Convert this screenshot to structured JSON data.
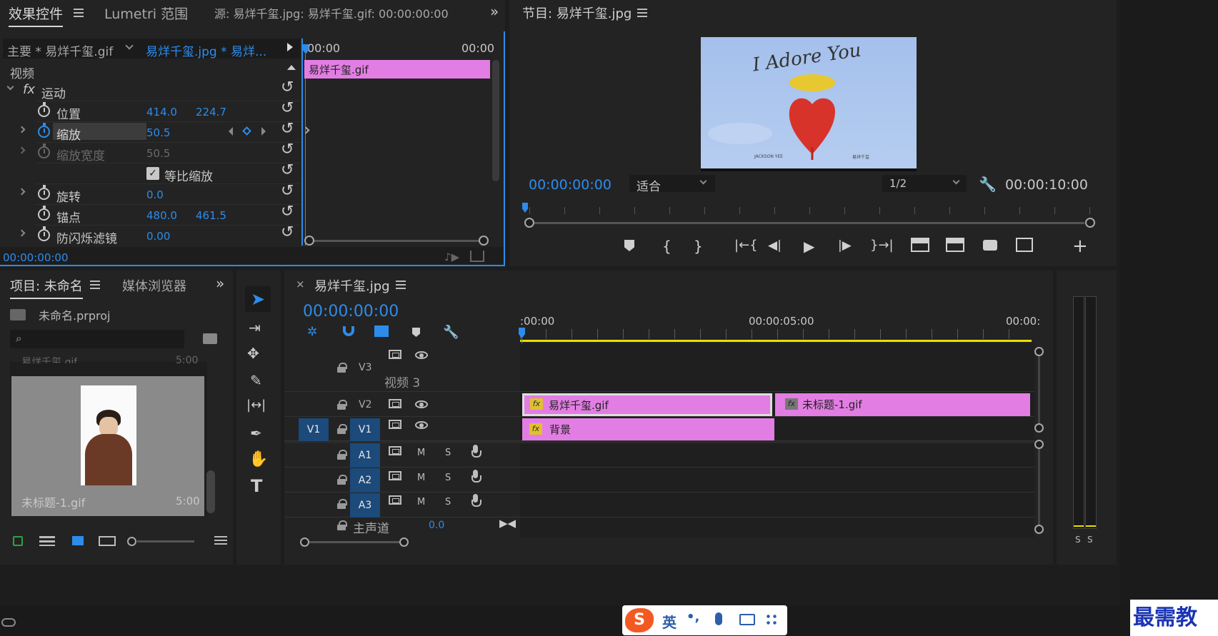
{
  "effect_controls": {
    "tab_label": "效果控件",
    "lumetri_tab": "Lumetri 范围",
    "source_label": "源: 易烊千玺.jpg: 易烊千玺.gif: 00:00:00:00",
    "master_clip": "主要 * 易烊千玺.gif",
    "sequence_clip": "易烊千玺.jpg * 易烊...",
    "ruler_start": "00:00",
    "ruler_end": "00:00",
    "timeline_clip": "易烊千玺.gif",
    "video_header": "视频",
    "fx_symbol": "fx",
    "motion_label": "运动",
    "properties": [
      {
        "name": "位置",
        "v1": "414.0",
        "v2": "224.7"
      },
      {
        "name": "缩放",
        "v1": "50.5",
        "v2": ""
      },
      {
        "name": "缩放宽度",
        "v1": "50.5",
        "v2": ""
      },
      {
        "name": "等比缩放",
        "v1": "",
        "v2": ""
      },
      {
        "name": "旋转",
        "v1": "0.0",
        "v2": ""
      },
      {
        "name": "锚点",
        "v1": "480.0",
        "v2": "461.5"
      },
      {
        "name": "防闪烁滤镜",
        "v1": "0.00",
        "v2": ""
      }
    ],
    "timecode": "00:00:00:00"
  },
  "program_monitor": {
    "title": "节目: 易烊千玺.jpg",
    "image_title": "I Adore You",
    "image_credit_left": "JACKSON YEE",
    "image_credit_right": "易烊千玺",
    "timecode_current": "00:00:00:00",
    "fit_select": "适合",
    "resolution_select": "1/2",
    "timecode_duration": "00:00:10:00"
  },
  "project": {
    "tab_label": "项目: 未命名",
    "media_tab": "媒体浏览器",
    "project_file": "未命名.prproj",
    "search_placeholder": "",
    "item_partial_name": "易烊千玺.gif",
    "item_partial_duration": "5:00",
    "item_name": "未标题-1.gif",
    "item_duration": "5:00"
  },
  "timeline": {
    "tab_label": "易烊千玺.jpg",
    "timecode": "00:00:00:00",
    "ruler_labels": [
      ":00:00",
      "00:00:05:00",
      "00:00:"
    ],
    "tracks": {
      "v3": "V3",
      "v3_name": "视频 3",
      "v2": "V2",
      "v1_source": "V1",
      "v1": "V1",
      "a1": "A1",
      "a2": "A2",
      "a3": "A3",
      "master": "主声道",
      "master_value": "0.0"
    },
    "clips": {
      "v2_a": "易烊千玺.gif",
      "v2_b": "未标题-1.gif",
      "v1_a": "背景"
    },
    "mute_label": "M",
    "solo_label": "S"
  },
  "audio_meter": {
    "solo_labels": [
      "S",
      "S"
    ]
  },
  "ime": {
    "lang": "英",
    "punct": "•,"
  },
  "watermark": "最需教育",
  "colors": {
    "accent": "#2d8ceb",
    "clip_pink": "#e27ee3",
    "playhead_yellow": "#e8e000"
  }
}
